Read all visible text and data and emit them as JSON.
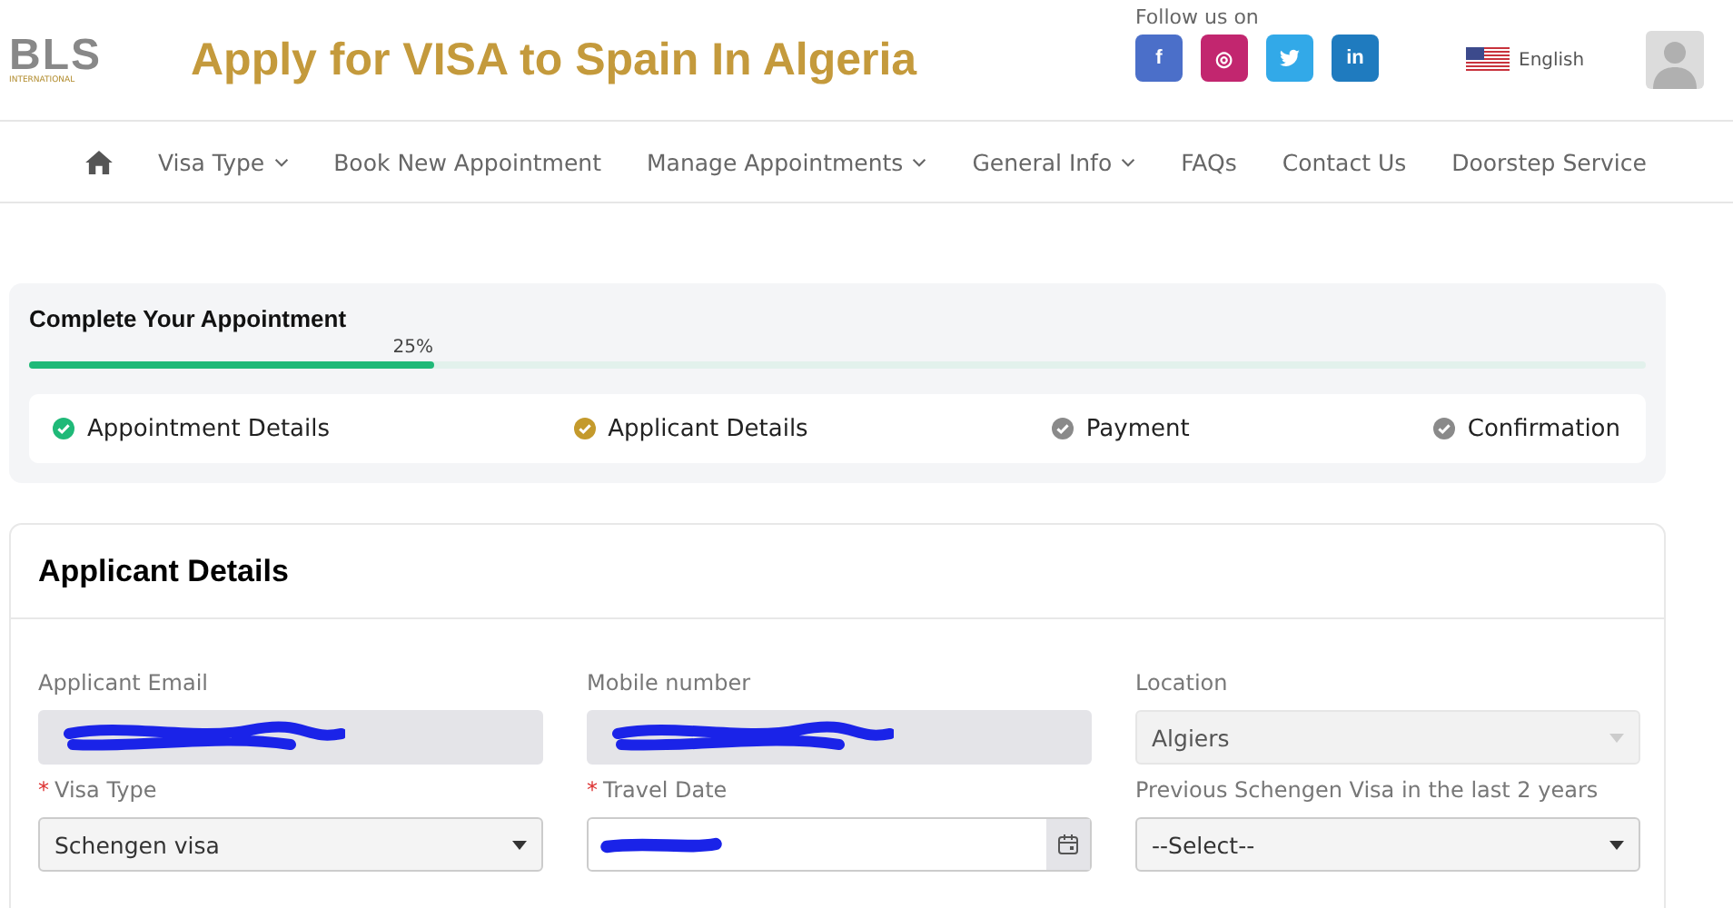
{
  "header": {
    "logo": {
      "letters": "BLS",
      "subtitle": "INTERNATIONAL"
    },
    "title": "Apply for VISA to Spain In Algeria",
    "follow_label": "Follow us on",
    "social": [
      {
        "kind": "facebook",
        "glyph": "f",
        "color": "#4b6fc9"
      },
      {
        "kind": "instagram",
        "glyph": "◎",
        "color": "#c2266f"
      },
      {
        "kind": "twitter",
        "color": "#32a9e8"
      },
      {
        "kind": "linkedin",
        "glyph": "in",
        "color": "#1f7bbf"
      }
    ],
    "language": "English"
  },
  "nav": [
    {
      "kind": "home"
    },
    {
      "kind": "link",
      "label": "Visa Type",
      "dropdown": true
    },
    {
      "kind": "link",
      "label": "Book New Appointment",
      "dropdown": false
    },
    {
      "kind": "link",
      "label": "Manage Appointments",
      "dropdown": true
    },
    {
      "kind": "link",
      "label": "General Info",
      "dropdown": true
    },
    {
      "kind": "link",
      "label": "FAQs",
      "dropdown": false
    },
    {
      "kind": "link",
      "label": "Contact Us",
      "dropdown": false
    },
    {
      "kind": "link",
      "label": "Doorstep Service",
      "dropdown": false
    }
  ],
  "progress": {
    "title": "Complete Your Appointment",
    "reading": "25%",
    "level": 0.25,
    "steps": [
      {
        "label": "Appointment Details",
        "kind": "done"
      },
      {
        "label": "Applicant Details",
        "kind": "current"
      },
      {
        "label": "Payment",
        "kind": "pending"
      },
      {
        "label": "Confirmation",
        "kind": "pending"
      }
    ]
  },
  "applicant": {
    "title": "Applicant Details",
    "fields": [
      {
        "kind": "text",
        "label": "Applicant Email",
        "readonly": true,
        "redacted": true
      },
      {
        "kind": "text",
        "label": "Mobile number",
        "readonly": true,
        "redacted": true
      },
      {
        "kind": "select",
        "label": "Location",
        "value": "Algiers",
        "disabled": true
      },
      {
        "kind": "select",
        "label": "Visa Type",
        "required_mark": "*",
        "value": "Schengen visa",
        "disabled": false
      },
      {
        "kind": "date",
        "label": "Travel Date",
        "required_mark": "*",
        "redacted": true
      },
      {
        "kind": "select",
        "label": "Previous Schengen Visa in the last 2 years",
        "value": "--Select--",
        "disabled": false
      }
    ]
  }
}
